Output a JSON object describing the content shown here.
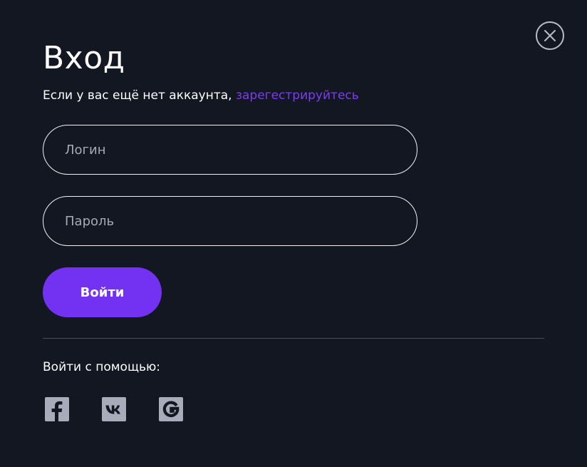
{
  "login_modal": {
    "title": "Вход",
    "subtitle_text": "Если у вас ещё нет аккаунта, ",
    "register_link": "зарегестрируйтесь",
    "login_placeholder": "Логин",
    "login_value": "",
    "password_placeholder": "Пароль",
    "password_value": "",
    "submit_label": "Войти",
    "social_label": "Войти с помощью:",
    "social_buttons": [
      {
        "icon": "facebook-icon"
      },
      {
        "icon": "vk-icon"
      },
      {
        "icon": "google-icon"
      }
    ]
  },
  "colors": {
    "background": "#131722",
    "accent": "#7331f2",
    "link": "#7b3cf4",
    "icon_gray": "#a7abba",
    "divider": "#4a4e5a"
  }
}
